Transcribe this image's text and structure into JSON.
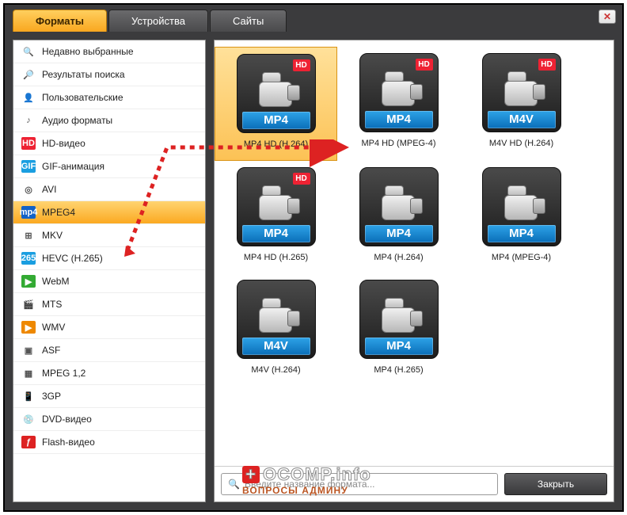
{
  "close_x": "✕",
  "tabs": [
    "Форматы",
    "Устройства",
    "Сайты"
  ],
  "active_tab": 0,
  "sidebar": [
    {
      "icon": "🔍",
      "bg": "",
      "label": "Недавно выбранные"
    },
    {
      "icon": "🔎",
      "bg": "",
      "label": "Результаты поиска"
    },
    {
      "icon": "👤",
      "bg": "",
      "label": "Пользовательские"
    },
    {
      "icon": "♪",
      "bg": "",
      "label": "Аудио форматы"
    },
    {
      "icon": "HD",
      "bg": "#e23",
      "label": "HD-видео"
    },
    {
      "icon": "GIF",
      "bg": "#1a9ee0",
      "label": "GIF-анимация"
    },
    {
      "icon": "◎",
      "bg": "",
      "label": "AVI"
    },
    {
      "icon": "mp4",
      "bg": "#1262c7",
      "label": "MPEG4",
      "selected": true
    },
    {
      "icon": "⊞",
      "bg": "",
      "label": "MKV"
    },
    {
      "icon": "265",
      "bg": "#1a9ee0",
      "label": "HEVC (H.265)"
    },
    {
      "icon": "▶",
      "bg": "#3a3",
      "label": "WebM"
    },
    {
      "icon": "🎬",
      "bg": "",
      "label": "MTS"
    },
    {
      "icon": "▶",
      "bg": "#e80",
      "label": "WMV"
    },
    {
      "icon": "▣",
      "bg": "",
      "label": "ASF"
    },
    {
      "icon": "▦",
      "bg": "",
      "label": "MPEG 1,2"
    },
    {
      "icon": "📱",
      "bg": "",
      "label": "3GP"
    },
    {
      "icon": "💿",
      "bg": "",
      "label": "DVD-видео"
    },
    {
      "icon": "ƒ",
      "bg": "#d22",
      "label": "Flash-видео"
    }
  ],
  "sidebar_selected_index": 7,
  "presets": [
    {
      "fmt": "MP4",
      "hd": true,
      "caption": "MP4 HD (H.264)",
      "selected": true
    },
    {
      "fmt": "MP4",
      "hd": true,
      "caption": "MP4 HD (MPEG-4)"
    },
    {
      "fmt": "M4V",
      "hd": true,
      "caption": "M4V HD (H.264)"
    },
    {
      "fmt": "MP4",
      "hd": true,
      "caption": "MP4 HD (H.265)"
    },
    {
      "fmt": "MP4",
      "hd": false,
      "caption": "MP4 (H.264)"
    },
    {
      "fmt": "MP4",
      "hd": false,
      "caption": "MP4 (MPEG-4)"
    },
    {
      "fmt": "M4V",
      "hd": false,
      "caption": "M4V (H.264)"
    },
    {
      "fmt": "MP4",
      "hd": false,
      "caption": "MP4 (H.265)"
    }
  ],
  "hd_badge_text": "HD",
  "search_placeholder": "Введите название формата...",
  "close_button": "Закрыть",
  "watermark": {
    "line1": "OCOMP.info",
    "line2": "ВОПРОСЫ АДМИНУ",
    "plus": "+"
  }
}
